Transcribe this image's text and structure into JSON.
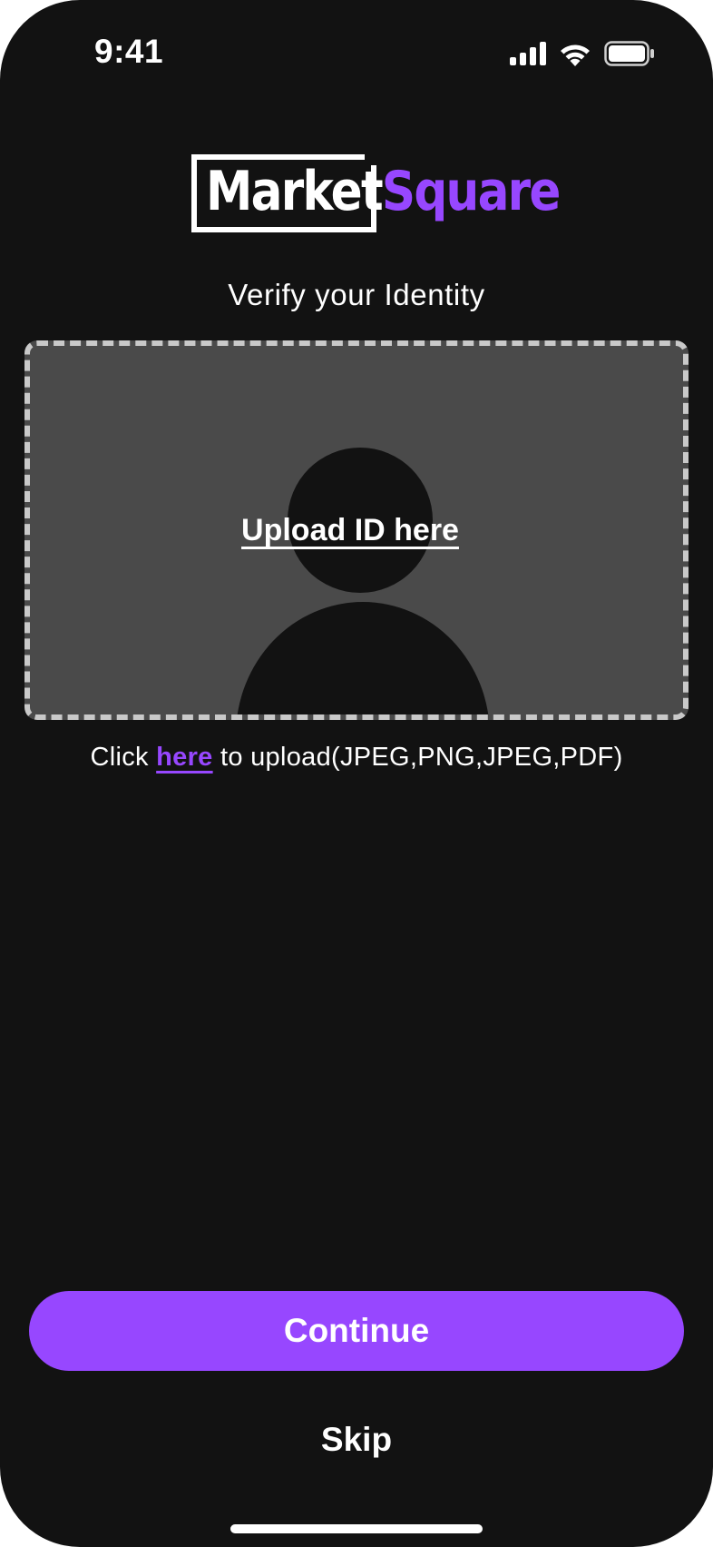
{
  "status_bar": {
    "time": "9:41",
    "icons": [
      "cellular-signal-icon",
      "wifi-icon",
      "battery-icon"
    ]
  },
  "logo": {
    "word_white": "Market",
    "word_purple": "Square"
  },
  "page": {
    "subtitle": "Verify your Identity"
  },
  "upload": {
    "label": "Upload ID here",
    "placeholder_icon": "person-silhouette-icon"
  },
  "hint": {
    "prefix": "Click ",
    "link": "here",
    "suffix": " to upload(JPEG,PNG,JPEG,PDF)"
  },
  "actions": {
    "continue_label": "Continue",
    "skip_label": "Skip"
  },
  "colors": {
    "background": "#121212",
    "accent": "#9747ff",
    "upload_fill": "#4a4a4a",
    "dashed_border": "#c9c9c9"
  }
}
